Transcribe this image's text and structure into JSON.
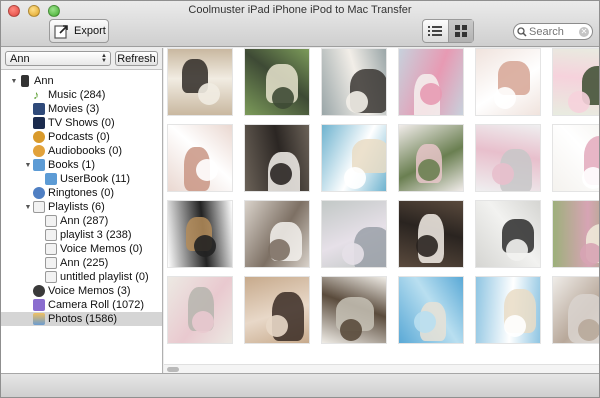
{
  "window": {
    "title": "Coolmuster iPad iPhone iPod to Mac Transfer"
  },
  "toolbar": {
    "export_label": "Export",
    "search": {
      "placeholder": "Search",
      "value": "Search"
    }
  },
  "sidebar": {
    "device": "Ann",
    "refresh_label": "Refresh",
    "tree": [
      {
        "label": "Ann",
        "icon": "iphone-icon"
      },
      {
        "label": "Music (284)",
        "icon": "music-note-icon"
      },
      {
        "label": "Movies (3)",
        "icon": "film-icon"
      },
      {
        "label": "TV Shows (0)",
        "icon": "tv-icon"
      },
      {
        "label": "Podcasts (0)",
        "icon": "podcast-icon"
      },
      {
        "label": "Audiobooks (0)",
        "icon": "audiobook-icon"
      },
      {
        "label": "Books (1)",
        "icon": "book-icon"
      },
      {
        "label": "UserBook (11)",
        "icon": "book-icon"
      },
      {
        "label": "Ringtones (0)",
        "icon": "ringtone-icon"
      },
      {
        "label": "Playlists (6)",
        "icon": "playlist-icon"
      },
      {
        "label": "Ann (287)",
        "icon": "playlist-icon"
      },
      {
        "label": "playlist 3 (238)",
        "icon": "playlist-icon"
      },
      {
        "label": "Voice Memos (0)",
        "icon": "playlist-icon"
      },
      {
        "label": "Ann (225)",
        "icon": "playlist-icon"
      },
      {
        "label": "untitled playlist (0)",
        "icon": "playlist-icon"
      },
      {
        "label": "Voice Memos (3)",
        "icon": "voice-memo-icon"
      },
      {
        "label": "Camera Roll (1072)",
        "icon": "camera-roll-icon"
      },
      {
        "label": "Photos (1586)",
        "icon": "photos-icon"
      }
    ]
  },
  "photos": [
    {
      "name": "couple-teddy-bear-photo",
      "colors": [
        "#c9b8a0",
        "#2f2a26",
        "#f1ece2"
      ]
    },
    {
      "name": "vw-bus-photo",
      "colors": [
        "#7c9b5a",
        "#e9e5cf",
        "#3e4a35"
      ]
    },
    {
      "name": "kissing-couple-photo",
      "colors": [
        "#9aa6a8",
        "#3a3632",
        "#f2eee8"
      ]
    },
    {
      "name": "wedding-cake-photo",
      "colors": [
        "#c7d1dc",
        "#f6f1ee",
        "#e79ab3"
      ]
    },
    {
      "name": "hands-rings-photo",
      "colors": [
        "#f0e3dd",
        "#d6a494",
        "#ffffff"
      ]
    },
    {
      "name": "bouquet-photo",
      "colors": [
        "#e8ece0",
        "#3a4b2f",
        "#f6d2dc"
      ]
    },
    {
      "name": "hands-ring-closeup-photo",
      "colors": [
        "#ead8d1",
        "#c99584",
        "#ffffff"
      ]
    },
    {
      "name": "dancing-couple-photo",
      "colors": [
        "#6b6258",
        "#f4f1ec",
        "#2b2623"
      ]
    },
    {
      "name": "beach-arch-photo",
      "colors": [
        "#6fb3cf",
        "#e9dcc4",
        "#ffffff"
      ]
    },
    {
      "name": "bride-bouquet-photo",
      "colors": [
        "#f1ecea",
        "#e8c6c9",
        "#6a7f51"
      ]
    },
    {
      "name": "birdcage-flowers-photo",
      "colors": [
        "#efeff0",
        "#c7c7c8",
        "#e8bfcc"
      ]
    },
    {
      "name": "white-cake-photo",
      "colors": [
        "#f4f2ee",
        "#e3a9bc",
        "#ffffff"
      ]
    },
    {
      "name": "teddy-bears-photo",
      "colors": [
        "#ffffff",
        "#b58d5b",
        "#222222"
      ]
    },
    {
      "name": "bride-portrait-photo",
      "colors": [
        "#d9d2ca",
        "#f5f2ee",
        "#7d7064"
      ]
    },
    {
      "name": "bridesmaids-photo",
      "colors": [
        "#c2c8c6",
        "#9aa0a8",
        "#e6e0e8"
      ]
    },
    {
      "name": "couple-flowers-photo",
      "colors": [
        "#5a4a3d",
        "#f4efe8",
        "#2a2420"
      ]
    },
    {
      "name": "bride-groom-photo",
      "colors": [
        "#d5d5d2",
        "#2b2b2b",
        "#f2f2f0"
      ]
    },
    {
      "name": "vw-bus-flowers-photo",
      "colors": [
        "#9cb07a",
        "#f1ecdc",
        "#d7a4b4"
      ]
    },
    {
      "name": "birdcage-bouquet-photo",
      "colors": [
        "#ece9e3",
        "#b6b5ae",
        "#e9c9cf"
      ]
    },
    {
      "name": "laughing-friends-photo",
      "colors": [
        "#c7aa8c",
        "#3a2c24",
        "#e8d8c8"
      ]
    },
    {
      "name": "teddy-sign-photo",
      "colors": [
        "#efece6",
        "#c7c2b6",
        "#5a4b3c"
      ]
    },
    {
      "name": "beach-couple-photo",
      "colors": [
        "#5aa9d6",
        "#e7e2d6",
        "#b9dff0"
      ]
    },
    {
      "name": "beach-running-photo",
      "colors": [
        "#8fc5e2",
        "#e9dcc6",
        "#ffffff"
      ]
    },
    {
      "name": "wedding-dress-photo",
      "colors": [
        "#efece8",
        "#d9d4cf",
        "#b8a89a"
      ]
    }
  ]
}
